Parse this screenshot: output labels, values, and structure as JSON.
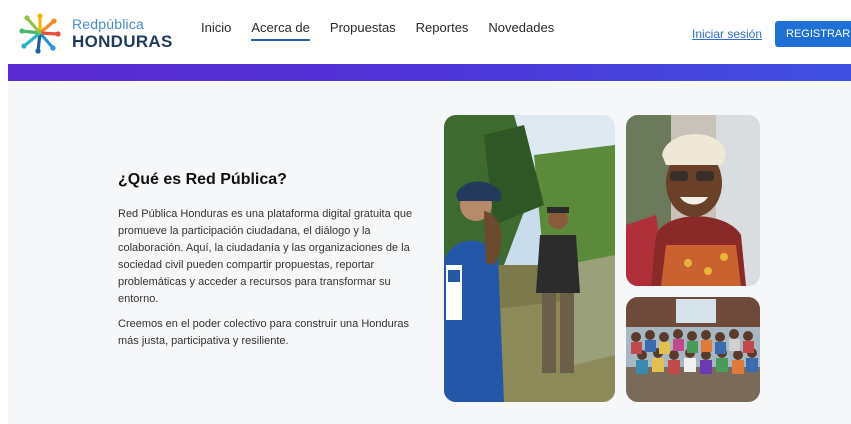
{
  "brand": {
    "name_top": "Redpública",
    "name_bottom": "HONDURAS"
  },
  "nav": {
    "items": [
      {
        "label": "Inicio"
      },
      {
        "label": "Acerca de"
      },
      {
        "label": "Propuestas"
      },
      {
        "label": "Reportes"
      },
      {
        "label": "Novedades"
      }
    ],
    "active": "Acerca de"
  },
  "auth": {
    "login_label": "Iniciar sesión",
    "register_label": "REGISTRARME"
  },
  "about": {
    "title": "¿Qué es Red Pública?",
    "paragraph1": "Red Pública Honduras es una plataforma digital gratuita que promueve la participación ciudadana, el diálogo y la colaboración. Aquí, la ciudadanía y las organizaciones de la sociedad civil pueden compartir propuestas, reportar problemáticas y acceder a recursos para transformar su entorno.",
    "paragraph2": "Creemos en el poder colectivo para construir una Honduras más justa, participativa y resiliente."
  },
  "colors": {
    "accent": "#1f6fd6",
    "band_start": "#5a2ad0",
    "band_end": "#3f4fe2",
    "brand_dark": "#1f3a5c"
  }
}
